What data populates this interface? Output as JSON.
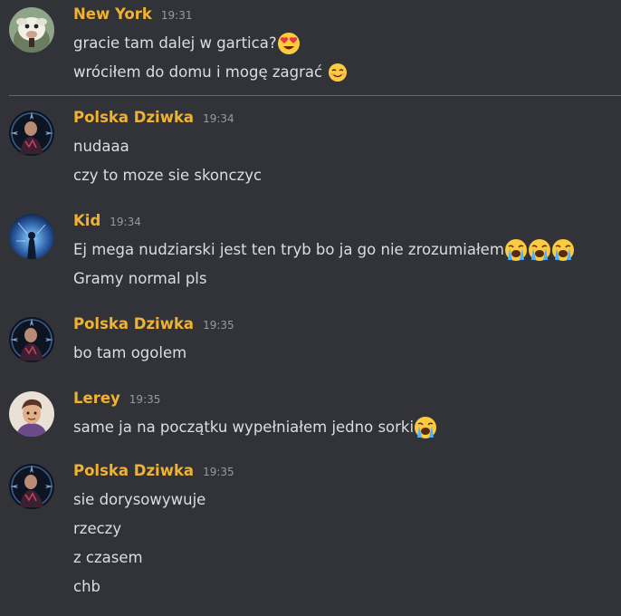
{
  "messages": [
    {
      "username": "New York",
      "time": "19:31",
      "avatar": "new-york-avatar",
      "lines": [
        {
          "text": "gracie tam dalej w gartica?",
          "emoji": [
            "heart-eyes-emoji"
          ]
        },
        {
          "text": "wróciłem do domu i mogę zagrać ",
          "emoji": [
            "smiling-face-emoji"
          ]
        }
      ]
    },
    {
      "username": "Polska Dziwka",
      "time": "19:34",
      "avatar": "polska-dziwka-avatar",
      "lines": [
        {
          "text": "nudaaa",
          "emoji": []
        },
        {
          "text": "czy to moze sie skonczyc",
          "emoji": []
        }
      ]
    },
    {
      "username": "Kid",
      "time": "19:34",
      "avatar": "kid-avatar",
      "lines": [
        {
          "text": "Ej mega nudziarski jest ten tryb bo ja go nie zrozumiałem",
          "emoji": [
            "loudly-crying-emoji",
            "loudly-crying-emoji",
            "loudly-crying-emoji"
          ]
        },
        {
          "text": "Gramy normal pls",
          "emoji": []
        }
      ]
    },
    {
      "username": "Polska Dziwka",
      "time": "19:35",
      "avatar": "polska-dziwka-avatar",
      "lines": [
        {
          "text": "bo tam ogolem",
          "emoji": []
        }
      ]
    },
    {
      "username": "Lerey",
      "time": "19:35",
      "avatar": "lerey-avatar",
      "lines": [
        {
          "text": "same ja na początku wypełniałem jedno sorki ",
          "emoji": [
            "loudly-crying-emoji"
          ]
        }
      ]
    },
    {
      "username": "Polska Dziwka",
      "time": "19:35",
      "avatar": "polska-dziwka-avatar",
      "lines": [
        {
          "text": "sie dorysowywuje",
          "emoji": []
        },
        {
          "text": "rzeczy",
          "emoji": []
        },
        {
          "text": "z czasem",
          "emoji": []
        },
        {
          "text": "chb",
          "emoji": []
        }
      ]
    }
  ],
  "colors": {
    "background": "#313338",
    "username": "#f0b232",
    "timestamp": "#949ba4",
    "message_text": "#dbdee1",
    "new_messages_divider": "#b5474a"
  }
}
